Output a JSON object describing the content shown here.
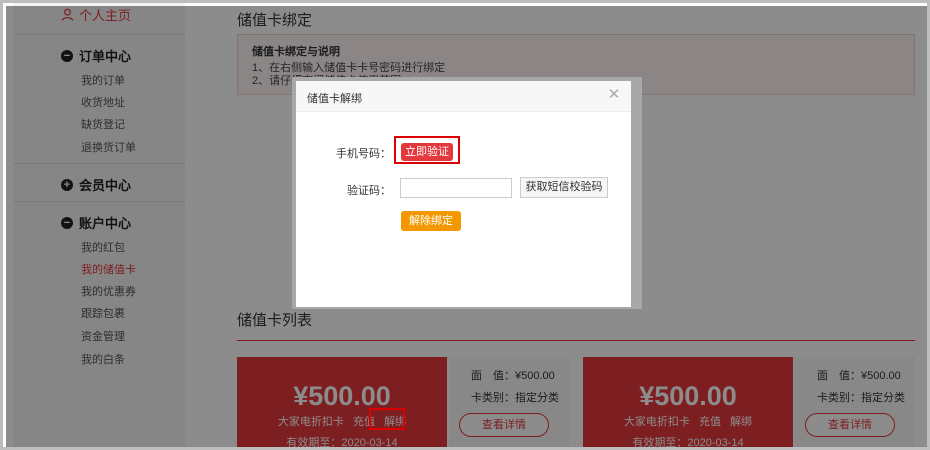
{
  "sidebar": {
    "home_label": "个人主页",
    "groups": [
      {
        "title": "订单中心",
        "icon": "minus-icon",
        "items": [
          "我的订单",
          "收货地址",
          "缺货登记",
          "退换货订单"
        ]
      },
      {
        "title": "会员中心",
        "icon": "plus-icon",
        "items": []
      },
      {
        "title": "账户中心",
        "icon": "minus-icon",
        "items": [
          "我的红包",
          "我的储值卡",
          "我的优惠券",
          "跟踪包裹",
          "资金管理",
          "我的白条"
        ]
      }
    ],
    "active_item": "我的储值卡"
  },
  "main": {
    "title": "储值卡绑定",
    "notice": {
      "heading": "储值卡绑定与说明",
      "line1": "1、在右侧输入储值卡卡号密码进行绑定",
      "line2": "2、请仔细查阅储值卡使用范围"
    },
    "list_title": "储值卡列表",
    "cards": [
      {
        "amount": "¥500.00",
        "name": "大家电折扣卡",
        "recharge": "充值",
        "unbind": "解绑",
        "expiry": "有效期至：2020-03-14",
        "face_label": "面　值：",
        "face_value": "¥500.00",
        "type_label": "卡类别：",
        "type_value": "指定分类",
        "detail": "查看详情"
      },
      {
        "amount": "¥500.00",
        "name": "大家电折扣卡",
        "recharge": "充值",
        "unbind": "解绑",
        "expiry": "有效期至：2020-03-14",
        "face_label": "面　值：",
        "face_value": "¥500.00",
        "type_label": "卡类别：",
        "type_value": "指定分类",
        "detail": "查看详情"
      }
    ]
  },
  "modal": {
    "title": "储值卡解绑",
    "close_icon": "close-icon",
    "phone_label": "手机号码：",
    "verify_button": "立即验证",
    "code_label": "验证码：",
    "code_value": "",
    "sms_button": "获取短信校验码",
    "unbind_button": "解除绑定"
  },
  "colors": {
    "accent": "#e4393c",
    "orange": "#f39800"
  }
}
